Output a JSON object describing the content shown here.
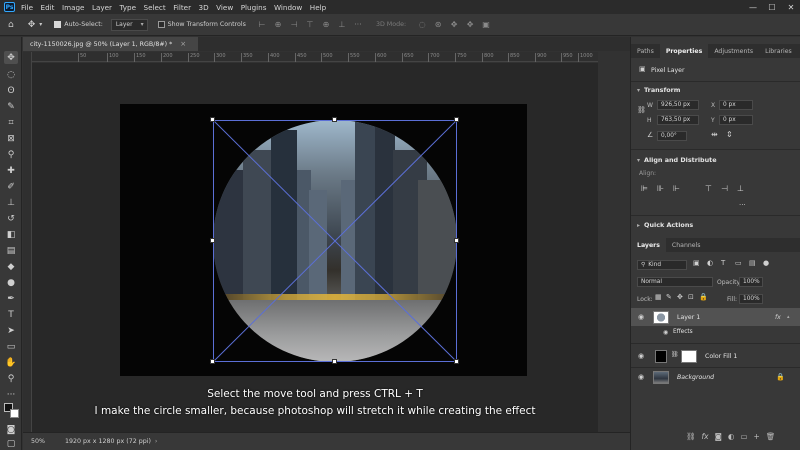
{
  "app": {
    "logo": "Ps"
  },
  "menu": [
    "File",
    "Edit",
    "Image",
    "Layer",
    "Type",
    "Select",
    "Filter",
    "3D",
    "View",
    "Plugins",
    "Window",
    "Help"
  ],
  "window_controls": [
    "—",
    "☐",
    "✕"
  ],
  "options_bar": {
    "auto_select_label": "Auto-Select:",
    "auto_select_checked": true,
    "auto_select_value": "Layer",
    "show_transform_label": "Show Transform Controls",
    "show_transform_checked": false,
    "mode_3d_label": "3D Mode:"
  },
  "document_tab": {
    "title": "city-1150026.jpg @ 50% (Layer 1, RGB/8#) *",
    "close": "×"
  },
  "ruler_ticks": [
    "50",
    "100",
    "150",
    "200",
    "250",
    "300",
    "350",
    "400",
    "450",
    "500",
    "550",
    "600",
    "650",
    "700",
    "750",
    "800",
    "850",
    "900",
    "950",
    "1000"
  ],
  "subtitles": {
    "line1": "Select the move tool and press CTRL + T",
    "line2": "I make the circle smaller, because photoshop will stretch it while creating the effect"
  },
  "status_bar": {
    "zoom": "50%",
    "doc_info": "1920 px x 1280 px (72 ppi)"
  },
  "top_panel": {
    "tabs": [
      "Paths",
      "Properties",
      "Adjustments",
      "Libraries"
    ],
    "active_tab": "Properties",
    "layer_type": "Pixel Layer",
    "transform": {
      "header": "Transform",
      "w_label": "W",
      "w_value": "926,50 px",
      "h_label": "H",
      "h_value": "763,50 px",
      "x_label": "X",
      "x_value": "0 px",
      "y_label": "Y",
      "y_value": "0 px",
      "angle_value": "0,00°"
    },
    "align": {
      "header": "Align and Distribute",
      "sub": "Align:"
    },
    "quick_actions": {
      "header": "Quick Actions"
    }
  },
  "layers_panel": {
    "tabs": [
      "Layers",
      "Channels"
    ],
    "active_tab": "Layers",
    "filter_kind": "Kind",
    "blend_mode": "Normal",
    "opacity_label": "Opacity:",
    "opacity_value": "100%",
    "lock_label": "Lock:",
    "fill_label": "Fill:",
    "fill_value": "100%",
    "layers": [
      {
        "name": "Layer 1",
        "fx": "fx",
        "effects_label": "Effects",
        "selected": true
      },
      {
        "name": "Color Fill 1",
        "selected": false
      },
      {
        "name": "Background",
        "selected": false
      }
    ],
    "bottom_icons": [
      "link-icon",
      "fx-icon",
      "mask-icon",
      "adjustment-icon",
      "group-icon",
      "new-layer-icon",
      "trash-icon"
    ],
    "bottom_glyphs": [
      "⛓",
      "fx",
      "◙",
      "◐",
      "▭",
      "+",
      "🗑"
    ]
  }
}
